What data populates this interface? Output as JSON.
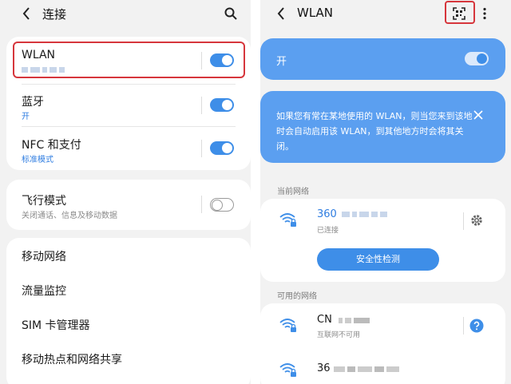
{
  "connections": {
    "title": "连接",
    "items": [
      {
        "label": "WLAN",
        "status": "",
        "toggle": "on"
      },
      {
        "label": "蓝牙",
        "status": "开",
        "toggle": "on"
      },
      {
        "label": "NFC 和支付",
        "status": "标准模式",
        "toggle": "on"
      },
      {
        "label": "飞行模式",
        "status": "关闭通话、信息及移动数据",
        "toggle": "off"
      },
      {
        "label": "移动网络"
      },
      {
        "label": "流量监控"
      },
      {
        "label": "SIM 卡管理器"
      },
      {
        "label": "移动热点和网络共享"
      }
    ]
  },
  "wlan": {
    "title": "WLAN",
    "master_label": "开",
    "master_toggle": "on",
    "tip": "如果您有常在某地使用的 WLAN，则当您来到该地时会自动启用该 WLAN，到其他地方时会将其关闭。",
    "current_section": "当前网络",
    "current": {
      "name": "360",
      "status": "已连接"
    },
    "check_button": "安全性检测",
    "available_section": "可用的网络",
    "available": [
      {
        "name": "CN",
        "status": "互联网不可用"
      },
      {
        "name": "36",
        "status": ""
      }
    ]
  },
  "colors": {
    "accent": "#3e8ee8",
    "highlight": "#d6363c",
    "tip_card": "#5b9ff0"
  },
  "icons": [
    "back-arrow-icon",
    "search-icon",
    "qr-scan-icon",
    "more-vert-icon",
    "close-icon",
    "wifi-lock-icon",
    "gear-icon",
    "help-icon"
  ]
}
